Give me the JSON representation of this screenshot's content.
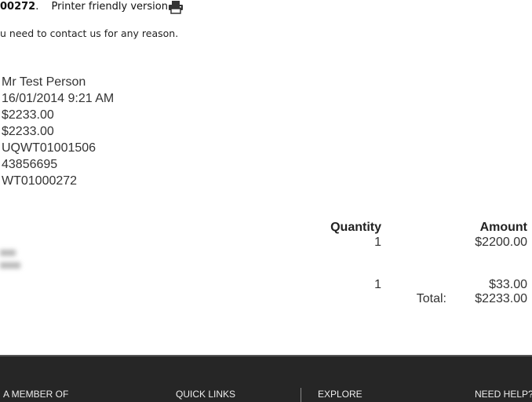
{
  "header": {
    "reference": "00272",
    "reference_suffix": ".",
    "printer_link": "Printer friendly version",
    "printer_icon": "printer-icon"
  },
  "contact_text": "u need to contact us for any reason.",
  "details": [
    "Mr Test Person",
    "16/01/2014 9:21 AM",
    "$2233.00",
    "$2233.00",
    "UQWT01001506",
    "43856695",
    "WT01000272"
  ],
  "table": {
    "headers": {
      "quantity": "Quantity",
      "amount": "Amount"
    },
    "rows": [
      {
        "quantity": "1",
        "amount": "$2200.00"
      },
      {
        "quantity": "1",
        "amount": "$33.00"
      }
    ],
    "total_label": "Total:",
    "total_amount": "$2233.00"
  },
  "footer": {
    "columns": [
      "A MEMBER OF",
      "QUICK LINKS",
      "EXPLORE",
      "NEED HELP?"
    ]
  }
}
